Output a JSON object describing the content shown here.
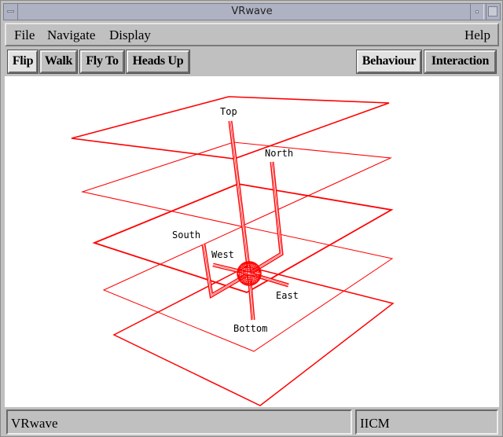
{
  "window": {
    "title": "VRwave"
  },
  "menubar": {
    "items": [
      {
        "label": "File"
      },
      {
        "label": "Navigate"
      },
      {
        "label": "Display"
      }
    ],
    "help_label": "Help"
  },
  "toolbar": {
    "navigation_modes": [
      {
        "label": "Flip",
        "active": true
      },
      {
        "label": "Walk",
        "active": false
      },
      {
        "label": "Fly To",
        "active": false
      },
      {
        "label": "Heads Up",
        "active": false
      }
    ],
    "behaviour_label": "Behaviour",
    "behaviour_active": true,
    "interaction_label": "Interaction",
    "interaction_active": false
  },
  "scene": {
    "line_color": "#ff0000",
    "background": "#ffffff",
    "plane_count": 5,
    "labels": {
      "top": "Top",
      "north": "North",
      "south": "South",
      "west": "West",
      "east": "East",
      "bottom": "Bottom"
    }
  },
  "statusbar": {
    "left_text": "VRwave",
    "right_text": "IICM"
  }
}
